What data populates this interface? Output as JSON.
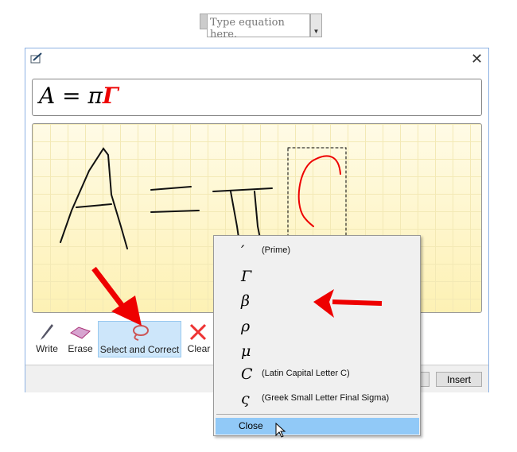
{
  "equation_box": {
    "placeholder": "Type equation here."
  },
  "dialog": {
    "formula_preview": {
      "main": "A = π",
      "highlighted": "Γ"
    },
    "toolbar": [
      {
        "label": "Write",
        "icon": "pen-icon"
      },
      {
        "label": "Erase",
        "icon": "eraser-icon"
      },
      {
        "label": "Select and Correct",
        "icon": "lasso-icon"
      },
      {
        "label": "Clear",
        "icon": "clear-x-icon"
      }
    ],
    "insert_label": "Insert",
    "accent": "#cde6fa"
  },
  "correction_menu": {
    "items": [
      {
        "symbol": "′",
        "desc": "(Prime)"
      },
      {
        "symbol": "Γ",
        "desc": ""
      },
      {
        "symbol": "β",
        "desc": ""
      },
      {
        "symbol": "ρ",
        "desc": ""
      },
      {
        "symbol": "μ",
        "desc": ""
      },
      {
        "symbol": "C",
        "desc": "(Latin Capital Letter C)"
      },
      {
        "symbol": "ς",
        "desc": "(Greek Small Letter Final Sigma)"
      }
    ],
    "close_label": "Close"
  },
  "annotation_color": "#ee0000"
}
